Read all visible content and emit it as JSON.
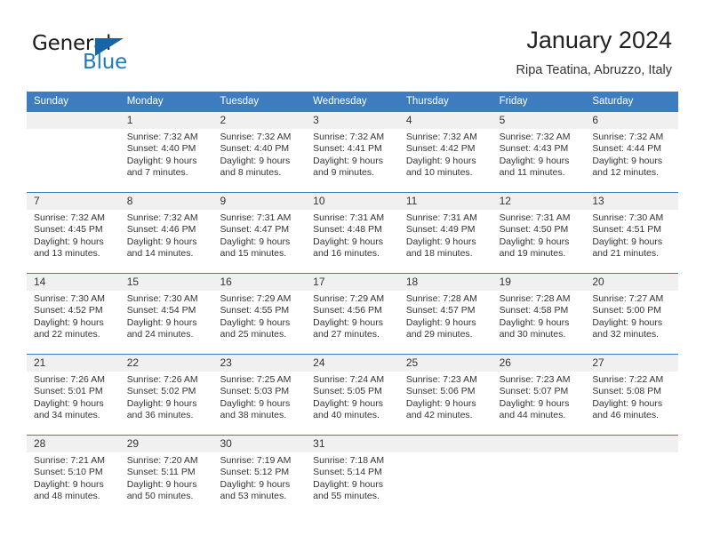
{
  "brand": {
    "word_one": "General",
    "word_two": "Blue",
    "triangle_icon": "triangle-icon"
  },
  "header": {
    "month_title": "January 2024",
    "location": "Ripa Teatina, Abruzzo, Italy"
  },
  "colors": {
    "header_blue": "#3d7dbf",
    "daynum_bg": "#f0f0f0",
    "brand_blue": "#1f7bc1",
    "triangle_blue": "#1565a8"
  },
  "weekdays": [
    "Sunday",
    "Monday",
    "Tuesday",
    "Wednesday",
    "Thursday",
    "Friday",
    "Saturday"
  ],
  "weeks": [
    [
      {
        "day": "",
        "sunrise": "",
        "sunset": "",
        "daylight_a": "",
        "daylight_b": ""
      },
      {
        "day": "1",
        "sunrise": "Sunrise: 7:32 AM",
        "sunset": "Sunset: 4:40 PM",
        "daylight_a": "Daylight: 9 hours",
        "daylight_b": "and 7 minutes."
      },
      {
        "day": "2",
        "sunrise": "Sunrise: 7:32 AM",
        "sunset": "Sunset: 4:40 PM",
        "daylight_a": "Daylight: 9 hours",
        "daylight_b": "and 8 minutes."
      },
      {
        "day": "3",
        "sunrise": "Sunrise: 7:32 AM",
        "sunset": "Sunset: 4:41 PM",
        "daylight_a": "Daylight: 9 hours",
        "daylight_b": "and 9 minutes."
      },
      {
        "day": "4",
        "sunrise": "Sunrise: 7:32 AM",
        "sunset": "Sunset: 4:42 PM",
        "daylight_a": "Daylight: 9 hours",
        "daylight_b": "and 10 minutes."
      },
      {
        "day": "5",
        "sunrise": "Sunrise: 7:32 AM",
        "sunset": "Sunset: 4:43 PM",
        "daylight_a": "Daylight: 9 hours",
        "daylight_b": "and 11 minutes."
      },
      {
        "day": "6",
        "sunrise": "Sunrise: 7:32 AM",
        "sunset": "Sunset: 4:44 PM",
        "daylight_a": "Daylight: 9 hours",
        "daylight_b": "and 12 minutes."
      }
    ],
    [
      {
        "day": "7",
        "sunrise": "Sunrise: 7:32 AM",
        "sunset": "Sunset: 4:45 PM",
        "daylight_a": "Daylight: 9 hours",
        "daylight_b": "and 13 minutes."
      },
      {
        "day": "8",
        "sunrise": "Sunrise: 7:32 AM",
        "sunset": "Sunset: 4:46 PM",
        "daylight_a": "Daylight: 9 hours",
        "daylight_b": "and 14 minutes."
      },
      {
        "day": "9",
        "sunrise": "Sunrise: 7:31 AM",
        "sunset": "Sunset: 4:47 PM",
        "daylight_a": "Daylight: 9 hours",
        "daylight_b": "and 15 minutes."
      },
      {
        "day": "10",
        "sunrise": "Sunrise: 7:31 AM",
        "sunset": "Sunset: 4:48 PM",
        "daylight_a": "Daylight: 9 hours",
        "daylight_b": "and 16 minutes."
      },
      {
        "day": "11",
        "sunrise": "Sunrise: 7:31 AM",
        "sunset": "Sunset: 4:49 PM",
        "daylight_a": "Daylight: 9 hours",
        "daylight_b": "and 18 minutes."
      },
      {
        "day": "12",
        "sunrise": "Sunrise: 7:31 AM",
        "sunset": "Sunset: 4:50 PM",
        "daylight_a": "Daylight: 9 hours",
        "daylight_b": "and 19 minutes."
      },
      {
        "day": "13",
        "sunrise": "Sunrise: 7:30 AM",
        "sunset": "Sunset: 4:51 PM",
        "daylight_a": "Daylight: 9 hours",
        "daylight_b": "and 21 minutes."
      }
    ],
    [
      {
        "day": "14",
        "sunrise": "Sunrise: 7:30 AM",
        "sunset": "Sunset: 4:52 PM",
        "daylight_a": "Daylight: 9 hours",
        "daylight_b": "and 22 minutes."
      },
      {
        "day": "15",
        "sunrise": "Sunrise: 7:30 AM",
        "sunset": "Sunset: 4:54 PM",
        "daylight_a": "Daylight: 9 hours",
        "daylight_b": "and 24 minutes."
      },
      {
        "day": "16",
        "sunrise": "Sunrise: 7:29 AM",
        "sunset": "Sunset: 4:55 PM",
        "daylight_a": "Daylight: 9 hours",
        "daylight_b": "and 25 minutes."
      },
      {
        "day": "17",
        "sunrise": "Sunrise: 7:29 AM",
        "sunset": "Sunset: 4:56 PM",
        "daylight_a": "Daylight: 9 hours",
        "daylight_b": "and 27 minutes."
      },
      {
        "day": "18",
        "sunrise": "Sunrise: 7:28 AM",
        "sunset": "Sunset: 4:57 PM",
        "daylight_a": "Daylight: 9 hours",
        "daylight_b": "and 29 minutes."
      },
      {
        "day": "19",
        "sunrise": "Sunrise: 7:28 AM",
        "sunset": "Sunset: 4:58 PM",
        "daylight_a": "Daylight: 9 hours",
        "daylight_b": "and 30 minutes."
      },
      {
        "day": "20",
        "sunrise": "Sunrise: 7:27 AM",
        "sunset": "Sunset: 5:00 PM",
        "daylight_a": "Daylight: 9 hours",
        "daylight_b": "and 32 minutes."
      }
    ],
    [
      {
        "day": "21",
        "sunrise": "Sunrise: 7:26 AM",
        "sunset": "Sunset: 5:01 PM",
        "daylight_a": "Daylight: 9 hours",
        "daylight_b": "and 34 minutes."
      },
      {
        "day": "22",
        "sunrise": "Sunrise: 7:26 AM",
        "sunset": "Sunset: 5:02 PM",
        "daylight_a": "Daylight: 9 hours",
        "daylight_b": "and 36 minutes."
      },
      {
        "day": "23",
        "sunrise": "Sunrise: 7:25 AM",
        "sunset": "Sunset: 5:03 PM",
        "daylight_a": "Daylight: 9 hours",
        "daylight_b": "and 38 minutes."
      },
      {
        "day": "24",
        "sunrise": "Sunrise: 7:24 AM",
        "sunset": "Sunset: 5:05 PM",
        "daylight_a": "Daylight: 9 hours",
        "daylight_b": "and 40 minutes."
      },
      {
        "day": "25",
        "sunrise": "Sunrise: 7:23 AM",
        "sunset": "Sunset: 5:06 PM",
        "daylight_a": "Daylight: 9 hours",
        "daylight_b": "and 42 minutes."
      },
      {
        "day": "26",
        "sunrise": "Sunrise: 7:23 AM",
        "sunset": "Sunset: 5:07 PM",
        "daylight_a": "Daylight: 9 hours",
        "daylight_b": "and 44 minutes."
      },
      {
        "day": "27",
        "sunrise": "Sunrise: 7:22 AM",
        "sunset": "Sunset: 5:08 PM",
        "daylight_a": "Daylight: 9 hours",
        "daylight_b": "and 46 minutes."
      }
    ],
    [
      {
        "day": "28",
        "sunrise": "Sunrise: 7:21 AM",
        "sunset": "Sunset: 5:10 PM",
        "daylight_a": "Daylight: 9 hours",
        "daylight_b": "and 48 minutes."
      },
      {
        "day": "29",
        "sunrise": "Sunrise: 7:20 AM",
        "sunset": "Sunset: 5:11 PM",
        "daylight_a": "Daylight: 9 hours",
        "daylight_b": "and 50 minutes."
      },
      {
        "day": "30",
        "sunrise": "Sunrise: 7:19 AM",
        "sunset": "Sunset: 5:12 PM",
        "daylight_a": "Daylight: 9 hours",
        "daylight_b": "and 53 minutes."
      },
      {
        "day": "31",
        "sunrise": "Sunrise: 7:18 AM",
        "sunset": "Sunset: 5:14 PM",
        "daylight_a": "Daylight: 9 hours",
        "daylight_b": "and 55 minutes."
      },
      {
        "day": "",
        "sunrise": "",
        "sunset": "",
        "daylight_a": "",
        "daylight_b": ""
      },
      {
        "day": "",
        "sunrise": "",
        "sunset": "",
        "daylight_a": "",
        "daylight_b": ""
      },
      {
        "day": "",
        "sunrise": "",
        "sunset": "",
        "daylight_a": "",
        "daylight_b": ""
      }
    ]
  ]
}
